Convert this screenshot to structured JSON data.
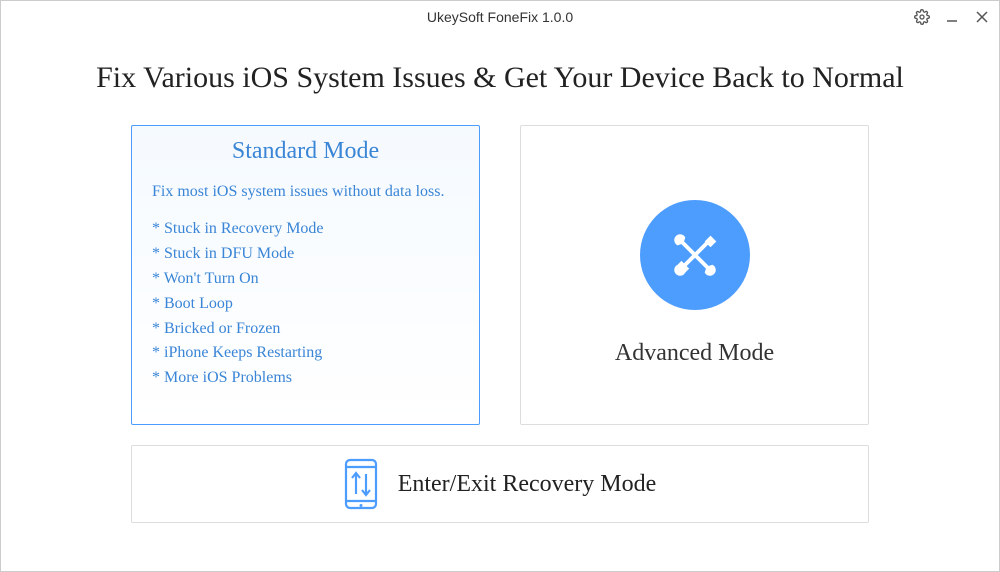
{
  "window": {
    "title": "UkeySoft FoneFix 1.0.0"
  },
  "heading": "Fix Various iOS System Issues & Get Your Device Back to Normal",
  "standard": {
    "title": "Standard Mode",
    "description": "Fix most iOS system issues without data loss.",
    "items": [
      "* Stuck in Recovery Mode",
      "* Stuck in DFU Mode",
      "* Won't Turn On",
      "* Boot Loop",
      "* Bricked or Frozen",
      "* iPhone Keeps Restarting",
      "* More iOS Problems"
    ]
  },
  "advanced": {
    "title": "Advanced Mode"
  },
  "recovery": {
    "label": "Enter/Exit Recovery Mode"
  },
  "colors": {
    "accent": "#4d9dff",
    "linkText": "#3a85d6"
  }
}
